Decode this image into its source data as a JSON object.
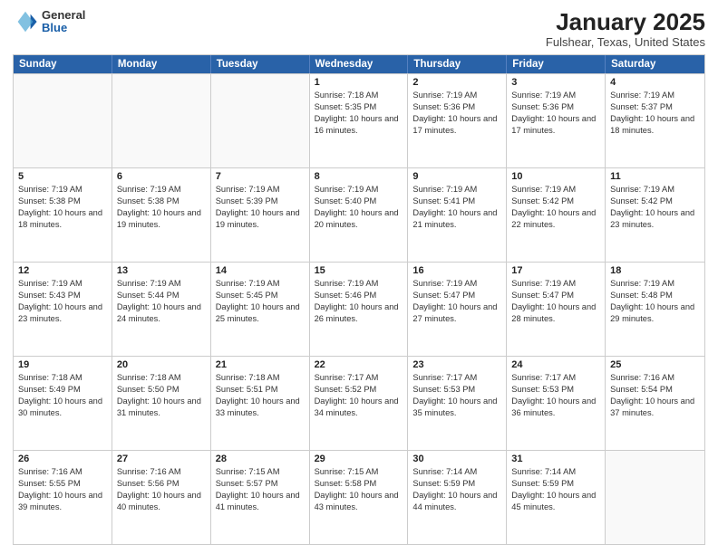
{
  "header": {
    "logo_general": "General",
    "logo_blue": "Blue",
    "title": "January 2025",
    "subtitle": "Fulshear, Texas, United States"
  },
  "days_of_week": [
    "Sunday",
    "Monday",
    "Tuesday",
    "Wednesday",
    "Thursday",
    "Friday",
    "Saturday"
  ],
  "weeks": [
    [
      {
        "day": "",
        "empty": true
      },
      {
        "day": "",
        "empty": true
      },
      {
        "day": "",
        "empty": true
      },
      {
        "day": "1",
        "sunrise": "7:18 AM",
        "sunset": "5:35 PM",
        "daylight": "10 hours and 16 minutes."
      },
      {
        "day": "2",
        "sunrise": "7:19 AM",
        "sunset": "5:36 PM",
        "daylight": "10 hours and 17 minutes."
      },
      {
        "day": "3",
        "sunrise": "7:19 AM",
        "sunset": "5:36 PM",
        "daylight": "10 hours and 17 minutes."
      },
      {
        "day": "4",
        "sunrise": "7:19 AM",
        "sunset": "5:37 PM",
        "daylight": "10 hours and 18 minutes."
      }
    ],
    [
      {
        "day": "5",
        "sunrise": "7:19 AM",
        "sunset": "5:38 PM",
        "daylight": "10 hours and 18 minutes."
      },
      {
        "day": "6",
        "sunrise": "7:19 AM",
        "sunset": "5:38 PM",
        "daylight": "10 hours and 19 minutes."
      },
      {
        "day": "7",
        "sunrise": "7:19 AM",
        "sunset": "5:39 PM",
        "daylight": "10 hours and 19 minutes."
      },
      {
        "day": "8",
        "sunrise": "7:19 AM",
        "sunset": "5:40 PM",
        "daylight": "10 hours and 20 minutes."
      },
      {
        "day": "9",
        "sunrise": "7:19 AM",
        "sunset": "5:41 PM",
        "daylight": "10 hours and 21 minutes."
      },
      {
        "day": "10",
        "sunrise": "7:19 AM",
        "sunset": "5:42 PM",
        "daylight": "10 hours and 22 minutes."
      },
      {
        "day": "11",
        "sunrise": "7:19 AM",
        "sunset": "5:42 PM",
        "daylight": "10 hours and 23 minutes."
      }
    ],
    [
      {
        "day": "12",
        "sunrise": "7:19 AM",
        "sunset": "5:43 PM",
        "daylight": "10 hours and 23 minutes."
      },
      {
        "day": "13",
        "sunrise": "7:19 AM",
        "sunset": "5:44 PM",
        "daylight": "10 hours and 24 minutes."
      },
      {
        "day": "14",
        "sunrise": "7:19 AM",
        "sunset": "5:45 PM",
        "daylight": "10 hours and 25 minutes."
      },
      {
        "day": "15",
        "sunrise": "7:19 AM",
        "sunset": "5:46 PM",
        "daylight": "10 hours and 26 minutes."
      },
      {
        "day": "16",
        "sunrise": "7:19 AM",
        "sunset": "5:47 PM",
        "daylight": "10 hours and 27 minutes."
      },
      {
        "day": "17",
        "sunrise": "7:19 AM",
        "sunset": "5:47 PM",
        "daylight": "10 hours and 28 minutes."
      },
      {
        "day": "18",
        "sunrise": "7:19 AM",
        "sunset": "5:48 PM",
        "daylight": "10 hours and 29 minutes."
      }
    ],
    [
      {
        "day": "19",
        "sunrise": "7:18 AM",
        "sunset": "5:49 PM",
        "daylight": "10 hours and 30 minutes."
      },
      {
        "day": "20",
        "sunrise": "7:18 AM",
        "sunset": "5:50 PM",
        "daylight": "10 hours and 31 minutes."
      },
      {
        "day": "21",
        "sunrise": "7:18 AM",
        "sunset": "5:51 PM",
        "daylight": "10 hours and 33 minutes."
      },
      {
        "day": "22",
        "sunrise": "7:17 AM",
        "sunset": "5:52 PM",
        "daylight": "10 hours and 34 minutes."
      },
      {
        "day": "23",
        "sunrise": "7:17 AM",
        "sunset": "5:53 PM",
        "daylight": "10 hours and 35 minutes."
      },
      {
        "day": "24",
        "sunrise": "7:17 AM",
        "sunset": "5:53 PM",
        "daylight": "10 hours and 36 minutes."
      },
      {
        "day": "25",
        "sunrise": "7:16 AM",
        "sunset": "5:54 PM",
        "daylight": "10 hours and 37 minutes."
      }
    ],
    [
      {
        "day": "26",
        "sunrise": "7:16 AM",
        "sunset": "5:55 PM",
        "daylight": "10 hours and 39 minutes."
      },
      {
        "day": "27",
        "sunrise": "7:16 AM",
        "sunset": "5:56 PM",
        "daylight": "10 hours and 40 minutes."
      },
      {
        "day": "28",
        "sunrise": "7:15 AM",
        "sunset": "5:57 PM",
        "daylight": "10 hours and 41 minutes."
      },
      {
        "day": "29",
        "sunrise": "7:15 AM",
        "sunset": "5:58 PM",
        "daylight": "10 hours and 43 minutes."
      },
      {
        "day": "30",
        "sunrise": "7:14 AM",
        "sunset": "5:59 PM",
        "daylight": "10 hours and 44 minutes."
      },
      {
        "day": "31",
        "sunrise": "7:14 AM",
        "sunset": "5:59 PM",
        "daylight": "10 hours and 45 minutes."
      },
      {
        "day": "",
        "empty": true
      }
    ]
  ],
  "labels": {
    "sunrise_prefix": "Sunrise: ",
    "sunset_prefix": "Sunset: ",
    "daylight_prefix": "Daylight: "
  }
}
